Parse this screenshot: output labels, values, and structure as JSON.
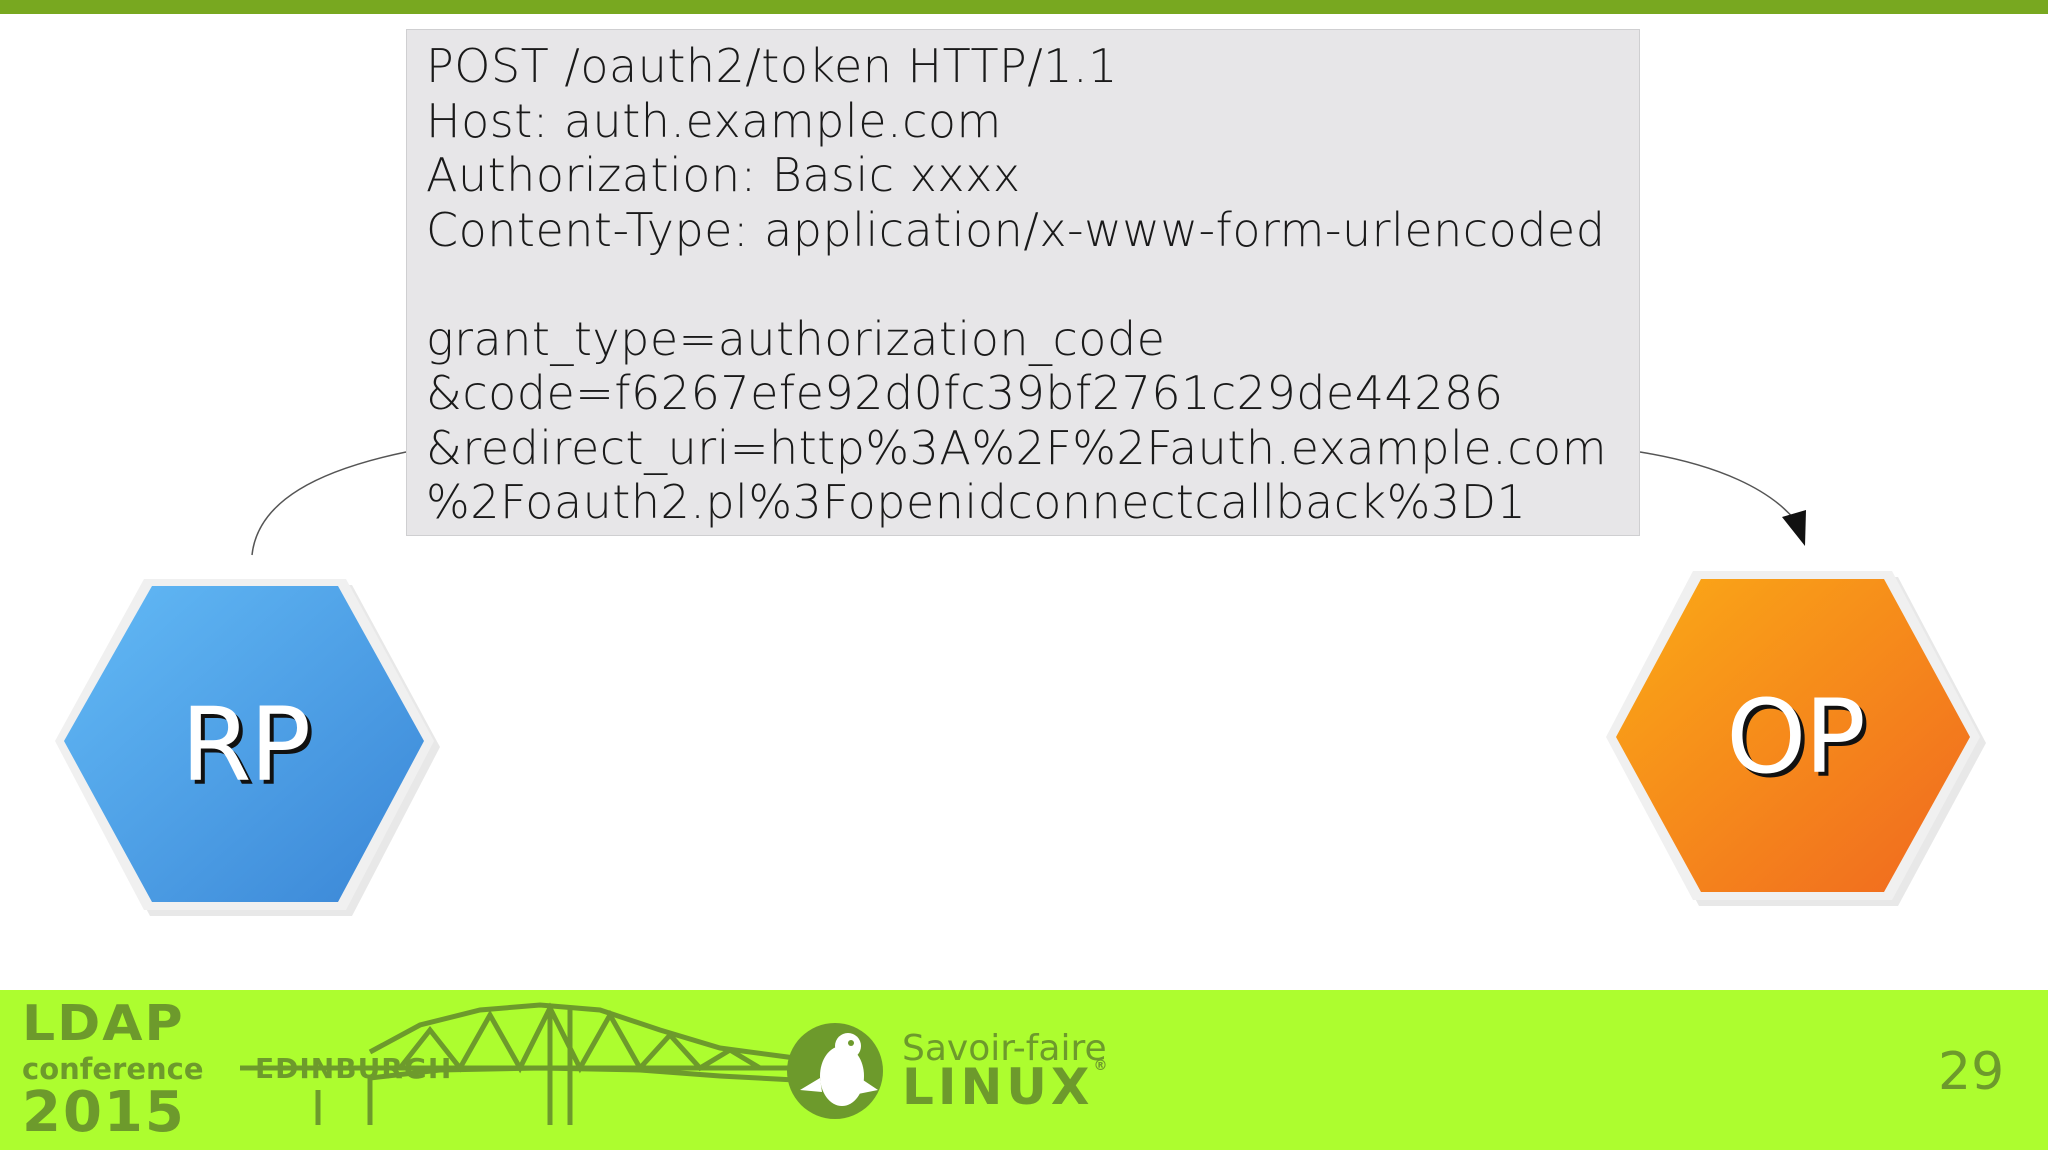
{
  "request": {
    "lines": [
      "POST /oauth2/token HTTP/1.1",
      "Host: auth.example.com",
      "Authorization: Basic xxxx",
      "Content-Type: application/x-www-form-urlencoded",
      "",
      "grant_type=authorization_code",
      "&code=f6267efe92d0fc39bf2761c29de44286",
      "&redirect_uri=http%3A%2F%2Fauth.example.com",
      "%2Foauth2.pl%3Fopenidconnectcallback%3D1"
    ]
  },
  "nodes": {
    "rp": {
      "label": "RP",
      "color_top": "#63baf6",
      "color_bottom": "#3a86d6"
    },
    "op": {
      "label": "OP",
      "color_top": "#fbaa16",
      "color_bottom": "#f06820"
    }
  },
  "footer": {
    "conference": {
      "ldap": "LDAP",
      "conference": "conference",
      "city": "EDINBURGH",
      "year": "2015"
    },
    "sponsor": {
      "line1": "Savoir-faire",
      "line2": "LINUX",
      "mark": "®"
    },
    "page_number": "29"
  },
  "colors": {
    "top_bar": "#78a820",
    "footer_bg": "#adfd2f",
    "logo_green": "#6d9a2c",
    "box_bg": "#e7e6e8"
  },
  "icons": [
    "penguin-icon",
    "forth-bridge-icon",
    "arrowhead-icon"
  ]
}
